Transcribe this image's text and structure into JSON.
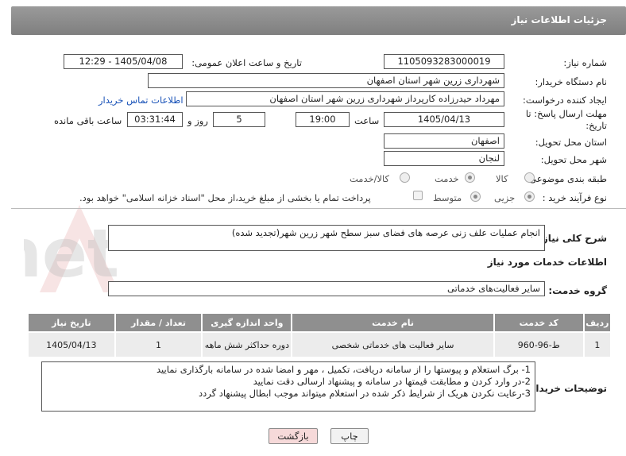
{
  "header": {
    "title": "جزئیات اطلاعات نیاز"
  },
  "fields": {
    "need_number_label": "شماره نیاز:",
    "need_number": "1105093283000019",
    "announce_label": "تاریخ و ساعت اعلان عمومی:",
    "announce_value": "1405/04/08 - 12:29",
    "buyer_org_label": "نام دستگاه خریدار:",
    "buyer_org": "شهرداری زرین شهر استان اصفهان",
    "creator_label": "ایجاد کننده درخواست:",
    "creator": "مهرداد حیدرزاده کارپرداز شهرداری زرین شهر استان اصفهان",
    "contact_link": "اطلاعات تماس خریدار",
    "deadline_label": "مهلت ارسال پاسخ: تا تاریخ:",
    "deadline_date": "1405/04/13",
    "time_label": "ساعت",
    "deadline_time": "19:00",
    "days_value": "5",
    "days_label": "روز و",
    "remaining_time": "03:31:44",
    "remaining_label": "ساعت باقی مانده",
    "province_label": "استان محل تحویل:",
    "province": "اصفهان",
    "city_label": "شهر محل تحویل:",
    "city": "لنجان",
    "category_label": "طبقه بندی موضوعی:",
    "category_options": [
      "کالا",
      "خدمت",
      "کالا/خدمت"
    ],
    "category_selected": "خدمت",
    "process_label": "نوع فرآیند خرید :",
    "process_options": [
      "جزیی",
      "متوسط"
    ],
    "process_selected": "جزیی",
    "treasury_note": "پرداخت تمام یا بخشی از مبلغ خرید،از محل \"اسناد خزانه اسلامی\" خواهد بود."
  },
  "description": {
    "label": "شرح کلی نیاز:",
    "text": "انجام عملیات علف زنی عرصه های فضای سبز سطح شهر زرین شهر(تجدید شده)"
  },
  "services": {
    "section_title": "اطلاعات خدمات مورد نیاز",
    "group_label": "گروه خدمت:",
    "group_value": "سایر فعالیت‌های خدماتی",
    "columns": [
      "ردیف",
      "کد خدمت",
      "نام خدمت",
      "واحد اندازه گیری",
      "تعداد / مقدار",
      "تاریخ نیاز"
    ],
    "rows": [
      [
        "1",
        "ط-96-960",
        "سایر فعالیت های خدماتی شخصی",
        "دوره حداکثر شش ماهه",
        "1",
        "1405/04/13"
      ]
    ]
  },
  "buyer_notes": {
    "label": "توضیحات خریدار:",
    "lines": [
      "1- برگ استعلام و پیوستها را از سامانه دریافت، تکمیل ، مهر و امضا شده در سامانه بارگذاری نمایید",
      "2-در وارد کردن و مطابقت قیمتها در سامانه و پیشنهاد ارسالی دقت نمایید",
      "3-رعایت نکردن هریک از شرایط  ذکر شده در استعلام میتواند موجب ابطال پیشنهاد گردد"
    ]
  },
  "buttons": {
    "print": "چاپ",
    "back": "بازگشت"
  },
  "watermark": {
    "text": "AriaTender.net"
  },
  "colors": {
    "header": "#8a8a8a",
    "link": "#1a53b8",
    "table_header": "#8f8f8f",
    "back_button": "#f6d9d9"
  }
}
